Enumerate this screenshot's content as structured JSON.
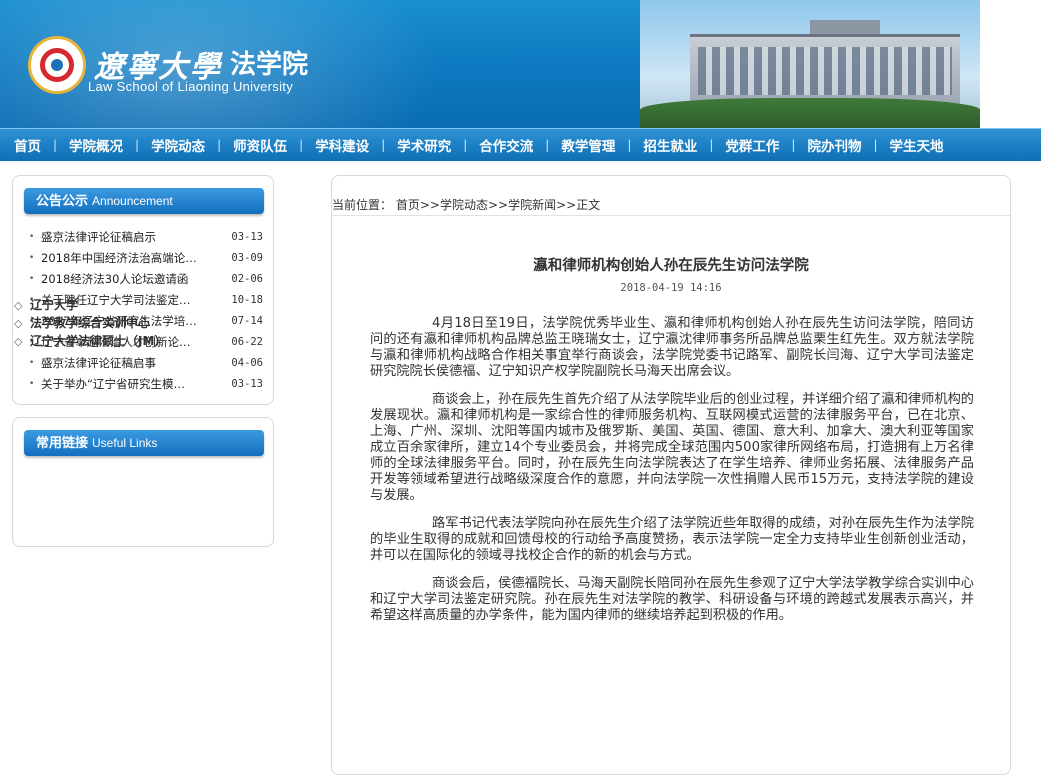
{
  "header": {
    "university_name": "遼寧大學",
    "school_name": "法学院",
    "school_name_en": "Law School  of Liaoning University"
  },
  "nav": [
    "首页",
    "学院概况",
    "学院动态",
    "师资队伍",
    "学科建设",
    "学术研究",
    "合作交流",
    "教学管理",
    "招生就业",
    "党群工作",
    "院办刊物",
    "学生天地"
  ],
  "nav_separator": "|",
  "announcement": {
    "title": "公告公示",
    "title_en": "Announcement",
    "items": [
      {
        "title": "盛京法律评论征稿启示",
        "date": "03-13"
      },
      {
        "title": "2018年中国经济法治高端论…",
        "date": "03-09"
      },
      {
        "title": "2018经济法30人论坛邀请函",
        "date": "02-06"
      },
      {
        "title": "关于聘任辽宁大学司法鉴定…",
        "date": "10-18"
      },
      {
        "title": "2017年辽宁省研究生法学培…",
        "date": "07-14"
      },
      {
        "title": "辽宁省卓越法治人才创新论…",
        "date": "06-22"
      },
      {
        "title": "盛京法律评论征稿启事",
        "date": "04-06"
      },
      {
        "title": "关于举办“辽宁省研究生模…",
        "date": "03-13"
      }
    ]
  },
  "links": {
    "title": "常用链接",
    "title_en": "Useful Links",
    "items": [
      "辽宁大学",
      "法学教学综合实训中心",
      "辽宁大学法律硕士（JM）"
    ]
  },
  "breadcrumb": {
    "prefix": "当前位置：",
    "items": [
      "首页",
      "学院动态",
      "学院新闻",
      "正文"
    ],
    "separator": ">>"
  },
  "article": {
    "title": "瀛和律师机构创始人孙在辰先生访问法学院",
    "date": "2018-04-19  14:16",
    "paragraphs": [
      "4月18日至19日，法学院优秀毕业生、瀛和律师机构创始人孙在辰先生访问法学院，陪同访问的还有瀛和律师机构品牌总监王晓瑞女士，辽宁瀛沈律师事务所品牌总监栗生红先生。双方就法学院与瀛和律师机构战略合作相关事宜举行商谈会，法学院党委书记路军、副院长闫海、辽宁大学司法鉴定研究院院长侯德福、辽宁知识产权学院副院长马海天出席会议。",
      "商谈会上，孙在辰先生首先介绍了从法学院毕业后的创业过程，并详细介绍了瀛和律师机构的发展现状。瀛和律师机构是一家综合性的律师服务机构、互联网模式运营的法律服务平台，已在北京、上海、广州、深圳、沈阳等国内城市及俄罗斯、美国、英国、德国、意大利、加拿大、澳大利亚等国家成立百余家律所，建立14个专业委员会，并将完成全球范围内500家律所网络布局，打造拥有上万名律师的全球法律服务平台。同时，孙在辰先生向法学院表达了在学生培养、律师业务拓展、法律服务产品开发等领域希望进行战略级深度合作的意愿，并向法学院一次性捐赠人民币15万元，支持法学院的建设与发展。",
      "路军书记代表法学院向孙在辰先生介绍了法学院近些年取得的成绩，对孙在辰先生作为法学院的毕业生取得的成就和回馈母校的行动给予高度赞扬，表示法学院一定全力支持毕业生创新创业活动，并可以在国际化的领域寻找校企合作的新的机会与方式。",
      "商谈会后，侯德福院长、马海天副院长陪同孙在辰先生参观了辽宁大学法学教学综合实训中心和辽宁大学司法鉴定研究院。孙在辰先生对法学院的教学、科研设备与环境的跨越式发展表示高兴，并希望这样高质量的办学条件，能为国内律师的继续培养起到积极的作用。"
    ]
  },
  "colors": {
    "header_blue": "#0d79c0",
    "nav_blue": "#1a7ec6",
    "title_blue": "#2a86d4"
  }
}
